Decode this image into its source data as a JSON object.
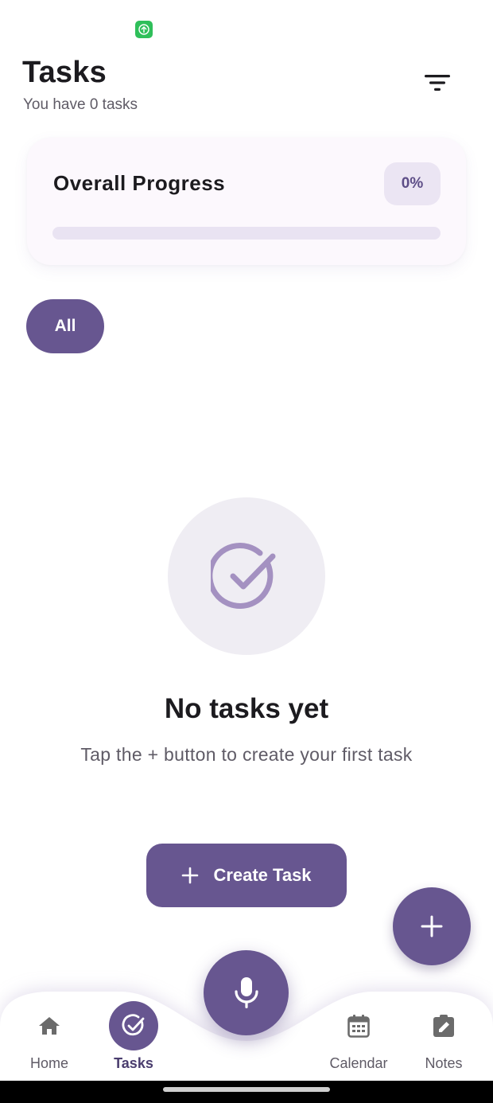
{
  "header": {
    "title": "Tasks",
    "subtitle": "You have 0 tasks"
  },
  "progress_card": {
    "title": "Overall Progress",
    "percent_label": "0%",
    "progress_fraction": 0
  },
  "filters": {
    "chips": [
      {
        "label": "All",
        "selected": true
      }
    ]
  },
  "empty_state": {
    "title": "No tasks yet",
    "message": "Tap the + button to create your first task",
    "button_label": "Create Task"
  },
  "bottom_nav": {
    "items": [
      {
        "label": "Home",
        "icon": "home-icon",
        "active": false
      },
      {
        "label": "Tasks",
        "icon": "check-circle-icon",
        "active": true
      },
      {
        "label": "Calendar",
        "icon": "calendar-icon",
        "active": false
      },
      {
        "label": "Notes",
        "icon": "note-edit-icon",
        "active": false
      }
    ],
    "center_button_icon": "mic-icon"
  },
  "colors": {
    "primary": "#675690",
    "surface": "#fcf8fd",
    "track": "#e9e3f2",
    "badge_bg": "#ebe5f3",
    "status_green": "#2fbf5a"
  }
}
